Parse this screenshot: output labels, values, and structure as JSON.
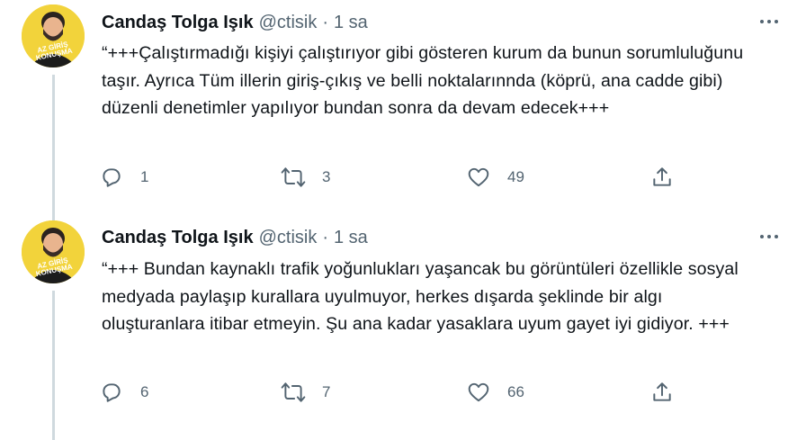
{
  "tweets": [
    {
      "author_name": "Candaş Tolga Işık",
      "handle": "@ctisik",
      "separator": "·",
      "time": "1 sa",
      "avatar_text": "AZ GİRİŞ KONUŞMA",
      "text": "“+++Çalıştırmadığı kişiyi çalıştırıyor gibi gösteren kurum da bunun sorumluluğunu taşır. Ayrıca Tüm illerin giriş-çıkış ve belli noktalarınnda (köprü, ana cadde gibi) düzenli denetimler yapılıyor bundan sonra da devam edecek+++",
      "reply_count": "1",
      "retweet_count": "3",
      "like_count": "49"
    },
    {
      "author_name": "Candaş Tolga Işık",
      "handle": "@ctisik",
      "separator": "·",
      "time": "1 sa",
      "avatar_text": "AZ GİRİŞ KONUŞMA",
      "text": "“+++ Bundan kaynaklı trafik yoğunlukları yaşancak bu görüntüleri özellikle sosyal medyada paylaşıp kurallara uyulmuyor, herkes dışarda şeklinde bir algı oluşturanlara itibar etmeyin. Şu ana kadar yasaklara uyum gayet iyi gidiyor. +++",
      "reply_count": "6",
      "retweet_count": "7",
      "like_count": "66"
    }
  ],
  "icons": {
    "reply": "reply-icon",
    "retweet": "retweet-icon",
    "like": "heart-icon",
    "share": "share-icon",
    "more": "more-icon"
  },
  "colors": {
    "text": "#0f1419",
    "secondary": "#536471",
    "thread_line": "#cfd9de",
    "avatar_bg": "#f2d33b"
  }
}
